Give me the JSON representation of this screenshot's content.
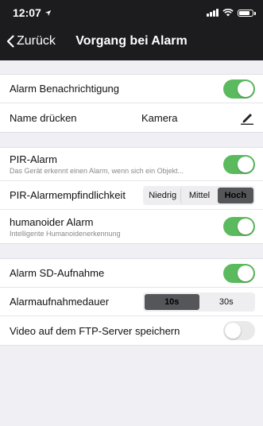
{
  "status_bar": {
    "time": "12:07"
  },
  "nav": {
    "back_label": "Zurück",
    "title": "Vorgang bei Alarm"
  },
  "group1": {
    "alarm_notification": {
      "label": "Alarm Benachrichtigung",
      "enabled": true
    },
    "name_press": {
      "label": "Name drücken",
      "value": "Kamera",
      "icon": "pencil-icon"
    }
  },
  "group2": {
    "pir_alarm": {
      "label": "PIR-Alarm",
      "subtitle": "Das Gerät erkennt einen Alarm, wenn sich ein Objekt...",
      "enabled": true
    },
    "pir_sensitivity": {
      "label": "PIR-Alarmempfindlichkeit",
      "options": [
        "Niedrig",
        "Mittel",
        "Hoch"
      ],
      "selected": "Hoch"
    },
    "humanoid_alarm": {
      "label": "humanoider Alarm",
      "subtitle": "Intelligente Humanoidenerkennung",
      "enabled": true
    }
  },
  "group3": {
    "sd_recording": {
      "label": "Alarm SD-Aufnahme",
      "enabled": true
    },
    "record_duration": {
      "label": "Alarmaufnahmedauer",
      "options": [
        "10s",
        "30s"
      ],
      "selected": "10s"
    },
    "ftp_video": {
      "label": "Video auf dem FTP-Server speichern",
      "enabled": false
    }
  },
  "colors": {
    "toggle_on": "#5cba5e",
    "toggle_off": "#e9e9ea",
    "header_bg": "#1c1c1e",
    "segment_selected": "#555659"
  }
}
